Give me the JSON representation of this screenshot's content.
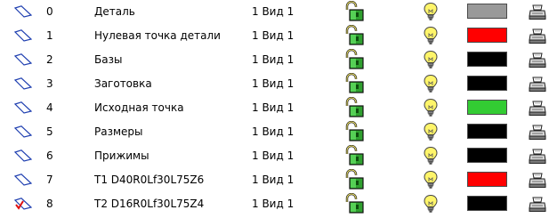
{
  "layers": [
    {
      "number": "0",
      "name": "Деталь",
      "view": "1 Вид 1",
      "color": "#999999",
      "current": false
    },
    {
      "number": "1",
      "name": "Нулевая точка детали",
      "view": "1 Вид 1",
      "color": "#ff0000",
      "current": false
    },
    {
      "number": "2",
      "name": "Базы",
      "view": "1 Вид 1",
      "color": "#000000",
      "current": false
    },
    {
      "number": "3",
      "name": "Заготовка",
      "view": "1 Вид 1",
      "color": "#000000",
      "current": false
    },
    {
      "number": "4",
      "name": "Исходная точка",
      "view": "1 Вид 1",
      "color": "#33cc33",
      "current": false
    },
    {
      "number": "5",
      "name": "Размеры",
      "view": "1 Вид 1",
      "color": "#000000",
      "current": false
    },
    {
      "number": "6",
      "name": "Прижимы",
      "view": "1 Вид 1",
      "color": "#000000",
      "current": false
    },
    {
      "number": "7",
      "name": "T1 D40R0Lf30L75Z6",
      "view": "1 Вид 1",
      "color": "#ff0000",
      "current": false
    },
    {
      "number": "8",
      "name": "T2 D16R0Lf30L75Z4",
      "view": "1 Вид 1",
      "color": "#000000",
      "current": true
    }
  ],
  "icons": {
    "layer": "layer-plane-icon",
    "current": "checkmark-icon",
    "lock": "unlocked-padlock-icon",
    "visibility": "lightbulb-icon",
    "print": "printer-icon"
  }
}
